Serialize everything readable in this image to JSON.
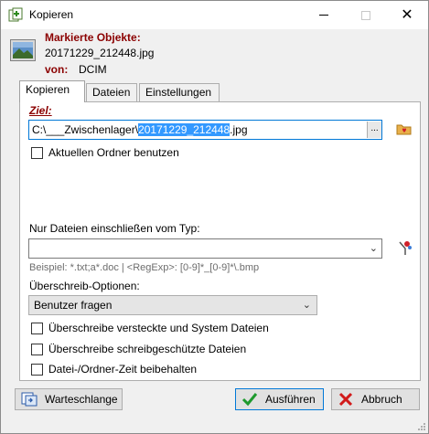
{
  "window": {
    "title": "Kopieren",
    "min_icon": "minimize-icon",
    "max_icon": "maximize-icon",
    "close_icon": "close-icon",
    "close_glyph": "✕"
  },
  "header": {
    "marked_label": "Markierte Objekte:",
    "filename": "20171229_212448.jpg",
    "von_label": "von:",
    "von_value": "DCIM"
  },
  "tabs": [
    {
      "label": "Kopieren",
      "active": true
    },
    {
      "label": "Dateien",
      "active": false
    },
    {
      "label": "Einstellungen",
      "active": false
    }
  ],
  "ziel": {
    "label": "Ziel:",
    "value_prefix": "C:\\___Zwischenlager\\",
    "value_selected": "20171229_212448",
    "value_suffix": ".jpg",
    "browse_label": "..."
  },
  "use_current_folder": {
    "label": "Aktuellen Ordner benutzen",
    "checked": false
  },
  "filter": {
    "label": "Nur Dateien einschließen vom Typ:",
    "value": "",
    "hint": "Beispiel: *.txt;a*.doc | <RegExp>: [0-9]*_[0-9]*\\.bmp"
  },
  "overwrite": {
    "label": "Überschreib-Optionen:",
    "selected": "Benutzer fragen"
  },
  "options": [
    {
      "label": "Überschreibe versteckte und System Dateien",
      "checked": false
    },
    {
      "label": "Überschreibe schreibgeschützte Dateien",
      "checked": false
    },
    {
      "label": "Datei-/Ordner-Zeit beibehalten",
      "checked": false
    }
  ],
  "buttons": {
    "queue": "Warteschlange",
    "run": "Ausführen",
    "cancel": "Abbruch"
  },
  "colors": {
    "accent_red": "#8b0000",
    "selection": "#3399ff",
    "focus_border": "#0078d7"
  }
}
